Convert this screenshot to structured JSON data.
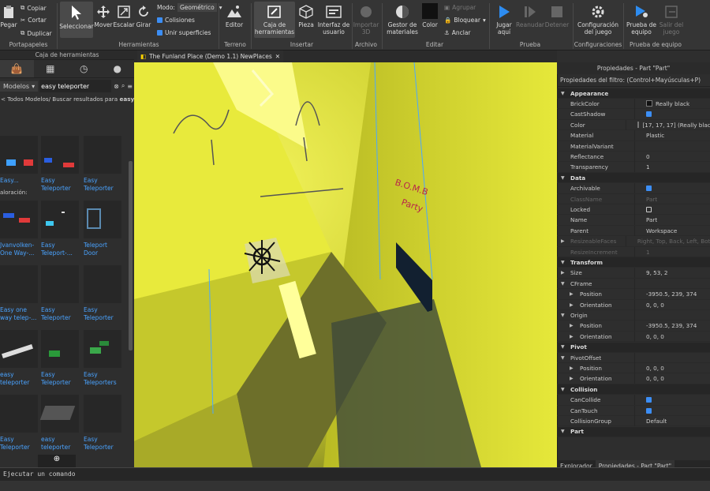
{
  "ribbon": {
    "clipboard": {
      "paste": "Pegar",
      "copy": "Copiar",
      "cut": "Cortar",
      "duplicate": "Duplicar",
      "group": "Portapapeles"
    },
    "tools": {
      "select": "Seleccionar",
      "move": "Mover",
      "scale": "Escalar",
      "rotate": "Girar",
      "mode_label": "Modo:",
      "mode_value": "Geométrico",
      "collisions": "Colisiones",
      "join_surfaces": "Unir superficies",
      "group": "Herramientas"
    },
    "terrain": {
      "editor": "Editor",
      "group": "Terreno"
    },
    "insert": {
      "toolbox": "Caja de herramientas",
      "part": "Pieza",
      "ui": "Interfaz de usuario",
      "group": "Insertar"
    },
    "file": {
      "import3d": "Importar 3D",
      "group": "Archivo"
    },
    "edit": {
      "materials": "Gestor de materiales",
      "color": "Color",
      "group_btn": "Agrupar",
      "lock": "Bloquear",
      "anchor": "Anclar",
      "group": "Editar"
    },
    "test": {
      "play": "Jugar aquí",
      "resume": "Reanudar",
      "stop": "Detener",
      "group": "Prueba"
    },
    "settings": {
      "game_settings": "Configuración del juego",
      "group": "Configuraciones"
    },
    "team_test": {
      "team_test": "Prueba de equipo",
      "exit": "Salir del juego",
      "group": "Prueba de equipo"
    }
  },
  "toolbox": {
    "title": "Caja de herramientas",
    "category": "Modelos",
    "search_value": "easy teleporter",
    "breadcrumb_prefix": "< Todos Modelos/ Buscar resultados para ",
    "breadcrumb_query": "easy telep",
    "rating_label": "aloración:",
    "items": [
      [
        "Easy...",
        "Easy Teleporter",
        "Easy Teleporter"
      ],
      [
        "Jvanvolken- One Way-...",
        "Easy Teleport-...",
        "Teleport Door (EASY!)"
      ],
      [
        "Easy one way telep-...",
        "Easy Teleporter",
        "Easy Teleporter"
      ],
      [
        "easy teleporter",
        "Easy Teleporter",
        "Easy Teleporters"
      ],
      [
        "Easy Teleporter",
        "easy teleporter",
        "Easy Teleporter"
      ]
    ]
  },
  "editor_tab": {
    "title": "The Funland Place (Demo 1.1) NewPlaces"
  },
  "viewport": {
    "sign_line1": "B.O.M.B",
    "sign_line2": "Party"
  },
  "properties": {
    "title": "Propiedades - Part \"Part\"",
    "filter": "Propiedades del filtro: (Control+Mayúsculas+P)",
    "rows": [
      {
        "type": "sec",
        "name": "Appearance"
      },
      {
        "name": "BrickColor",
        "value": "Really black",
        "swatch": "#111111"
      },
      {
        "name": "CastShadow",
        "check": true
      },
      {
        "name": "Color",
        "value": "[17, 17, 17] (Really black)",
        "swatch": "#111111"
      },
      {
        "name": "Material",
        "value": "Plastic"
      },
      {
        "name": "MaterialVariant",
        "value": ""
      },
      {
        "name": "Reflectance",
        "value": "0"
      },
      {
        "name": "Transparency",
        "value": "1"
      },
      {
        "type": "sec",
        "name": "Data"
      },
      {
        "name": "Archivable",
        "check": true
      },
      {
        "name": "ClassName",
        "value": "Part",
        "dis": true
      },
      {
        "name": "Locked",
        "check": false
      },
      {
        "name": "Name",
        "value": "Part"
      },
      {
        "name": "Parent",
        "value": "Workspace"
      },
      {
        "name": "ResizeableFaces",
        "value": "Right, Top, Back, Left, Bottom",
        "dis": true,
        "exp": true
      },
      {
        "name": "ResizeIncrement",
        "value": "1",
        "dis": true
      },
      {
        "type": "sec",
        "name": "Transform"
      },
      {
        "name": "Size",
        "value": "9, 53, 2",
        "exp": true
      },
      {
        "name": "CFrame",
        "value": "",
        "open": true
      },
      {
        "name": "Position",
        "value": "-3950.5, 239, 374",
        "sub": true,
        "exp": true
      },
      {
        "name": "Orientation",
        "value": "0, 0, 0",
        "sub": true,
        "exp": true
      },
      {
        "name": "Origin",
        "value": "",
        "open": true
      },
      {
        "name": "Position",
        "value": "-3950.5, 239, 374",
        "sub": true,
        "exp": true
      },
      {
        "name": "Orientation",
        "value": "0, 0, 0",
        "sub": true,
        "exp": true
      },
      {
        "type": "sec",
        "name": "Pivot"
      },
      {
        "name": "PivotOffset",
        "value": "",
        "open": true
      },
      {
        "name": "Position",
        "value": "0, 0, 0",
        "sub": true,
        "exp": true
      },
      {
        "name": "Orientation",
        "value": "0, 0, 0",
        "sub": true,
        "exp": true
      },
      {
        "type": "sec",
        "name": "Collision"
      },
      {
        "name": "CanCollide",
        "check": true
      },
      {
        "name": "CanTouch",
        "check": true
      },
      {
        "name": "CollisionGroup",
        "value": "Default"
      },
      {
        "type": "sec",
        "name": "Part"
      }
    ],
    "bottom_tabs": [
      "Explorador",
      "Propiedades - Part \"Part\""
    ]
  },
  "command_bar": {
    "placeholder": "Ejecutar un comando"
  }
}
